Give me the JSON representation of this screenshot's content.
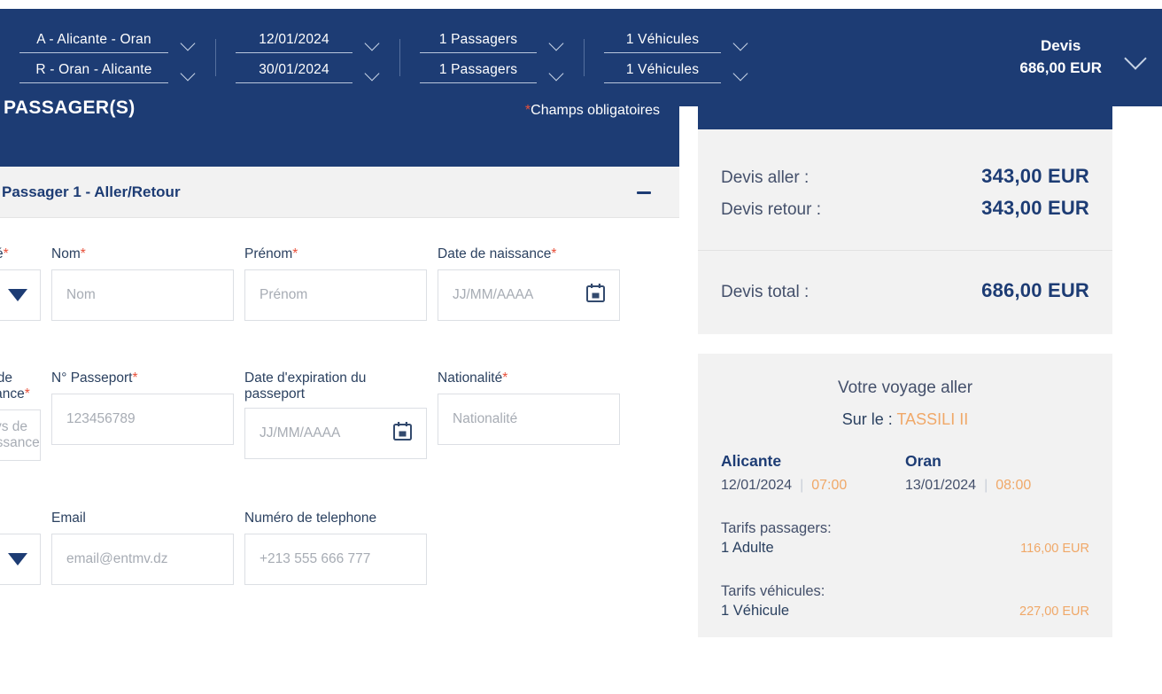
{
  "topbar": {
    "trip": {
      "outbound": "A - Alicante - Oran",
      "inbound": "R - Oran - Alicante"
    },
    "dates": {
      "departure": "12/01/2024",
      "return": "30/01/2024"
    },
    "passengers": {
      "outbound": "1 Passagers",
      "inbound": "1 Passagers"
    },
    "vehicles": {
      "outbound": "1 Véhicules",
      "inbound": "1 Véhicules"
    },
    "quote": {
      "label": "Devis",
      "amount": "686,00 EUR"
    }
  },
  "banner": {
    "title": "PASSAGER(S)",
    "required_note": "Champs obligatoires",
    "required_star": "*"
  },
  "section": {
    "title": "Passager 1 - Aller/Retour",
    "collapse_label": "−"
  },
  "form": {
    "rows": [
      {
        "fields": [
          {
            "name": "civilite",
            "label": "Civilité",
            "required": true,
            "type": "select",
            "value": "",
            "placeholder": ""
          },
          {
            "name": "nom",
            "label": "Nom",
            "required": true,
            "type": "text",
            "value": "",
            "placeholder": "Nom"
          },
          {
            "name": "prenom",
            "label": "Prénom",
            "required": true,
            "type": "text",
            "value": "",
            "placeholder": "Prénom"
          },
          {
            "name": "date-de-naissance",
            "label": "Date de naissance",
            "required": true,
            "type": "date",
            "value": "",
            "placeholder": "JJ/MM/AAAA"
          }
        ]
      },
      {
        "fields": [
          {
            "name": "pays-de-naissance",
            "label": "Pays de naissance",
            "required": true,
            "type": "text",
            "value": "",
            "placeholder": "Pays de naissance"
          },
          {
            "name": "no-passeport",
            "label": "N° Passeport",
            "required": true,
            "type": "text",
            "value": "",
            "placeholder": "123456789"
          },
          {
            "name": "date-expiration-passeport",
            "label": "Date d'expiration du\npasseport",
            "required": false,
            "type": "date",
            "value": "",
            "placeholder": "JJ/MM/AAAA"
          },
          {
            "name": "nationalite",
            "label": "Nationalité",
            "required": true,
            "type": "text",
            "value": "",
            "placeholder": "Nationalité"
          }
        ]
      },
      {
        "fields": [
          {
            "name": "indicatif",
            "label": "",
            "required": false,
            "type": "select",
            "value": "",
            "placeholder": ""
          },
          {
            "name": "email",
            "label": "Email",
            "required": false,
            "type": "text",
            "value": "",
            "placeholder": "email@entmv.dz"
          },
          {
            "name": "numero-de-telephone",
            "label": "Numéro de telephone",
            "required": false,
            "type": "text",
            "value": "",
            "placeholder": "+213 555 666 777"
          }
        ]
      }
    ]
  },
  "summary": {
    "prices": [
      {
        "label": "Devis aller :",
        "value": "343,00 EUR"
      },
      {
        "label": "Devis retour :",
        "value": "343,00 EUR"
      }
    ],
    "total": {
      "label": "Devis total :",
      "value": "686,00 EUR"
    }
  },
  "trip": {
    "heading": "Votre voyage aller",
    "ship_prefix": "Sur le :",
    "ship_name": "TASSILI II",
    "departure": {
      "port": "Alicante",
      "date": "12/01/2024",
      "time": "07:00"
    },
    "arrival": {
      "port": "Oran",
      "date": "13/01/2024",
      "time": "08:00"
    },
    "tariffs": [
      {
        "title": "Tarifs passagers:",
        "name": "1 Adulte",
        "price": "116,00 EUR"
      },
      {
        "title": "Tarifs véhicules:",
        "name": "1 Véhicule",
        "price": "227,00 EUR"
      }
    ]
  },
  "colors": {
    "brand_blue": "#1d3c74",
    "accent_orange": "#f0a868",
    "required_red": "#e8503a",
    "panel_grey": "#f2f2f2"
  }
}
